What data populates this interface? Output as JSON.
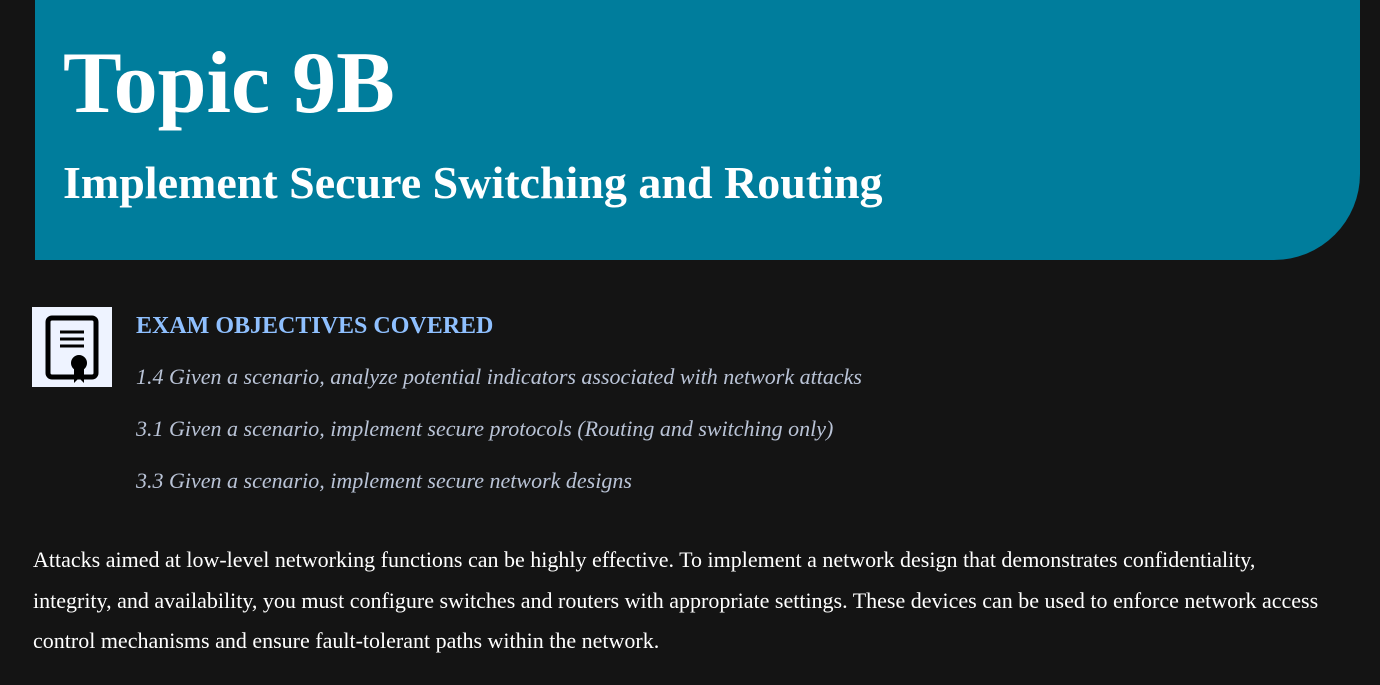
{
  "header": {
    "title": "Topic 9B",
    "subtitle": "Implement Secure Switching and Routing",
    "background_color": "#007d9c"
  },
  "objectives": {
    "icon": "certificate-icon",
    "heading": "EXAM OBJECTIVES COVERED",
    "heading_color": "#8fc0ff",
    "items": [
      "1.4 Given a scenario, analyze potential indicators associated with network attacks",
      "3.1 Given a scenario, implement secure protocols (Routing and switching only)",
      "3.3 Given a scenario, implement secure network designs"
    ]
  },
  "intro": {
    "text": "Attacks aimed at low-level networking functions can be highly effective. To implement a network design that demonstrates confidentiality, integrity, and availability, you must configure switches and routers with appropriate settings. These devices can be used to enforce network access control mechanisms and ensure fault-tolerant paths within the network."
  }
}
